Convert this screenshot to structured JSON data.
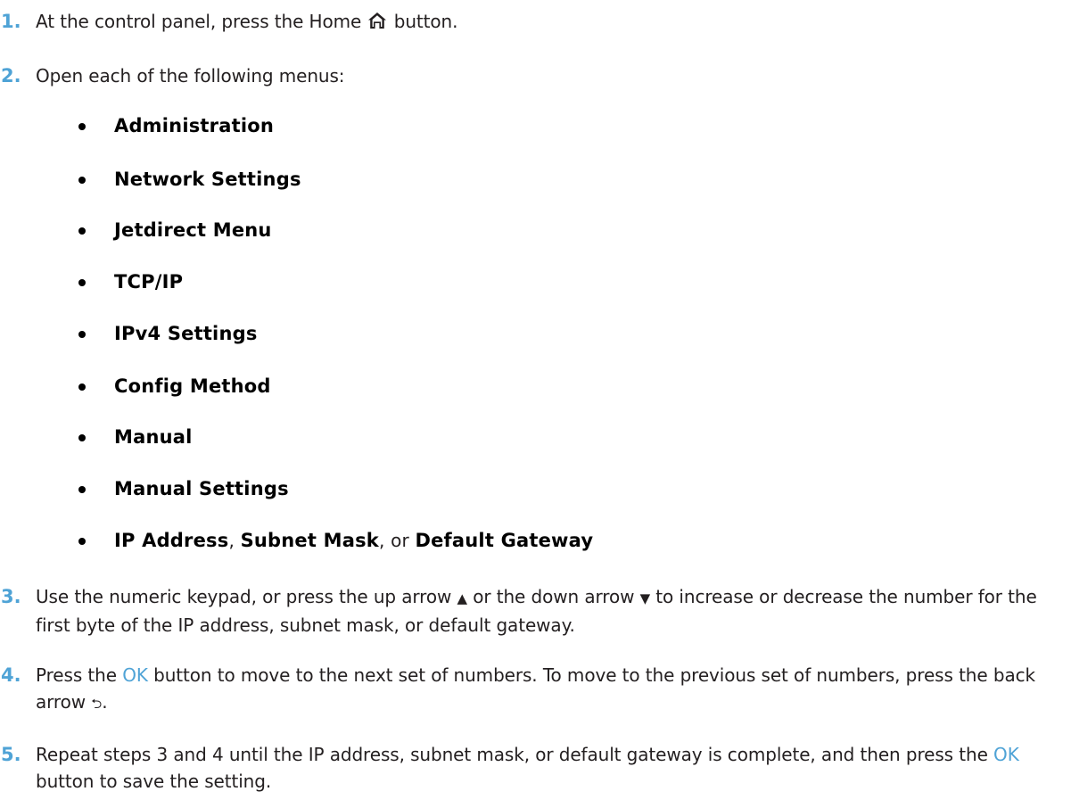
{
  "steps": {
    "s1": {
      "number": "1.",
      "text_before": "At the control panel, press the Home",
      "icon": "home-icon",
      "text_after": " button."
    },
    "s2": {
      "number": "2.",
      "text": "Open each of the following menus:"
    },
    "s3": {
      "number": "3.",
      "text_1": "Use the numeric keypad, or press the up arrow ",
      "up_arrow": "▲",
      "text_2": " or the down arrow ",
      "down_arrow": "▼",
      "text_3": " to increase or decrease the number for the first byte of the IP address, subnet mask, or default gateway."
    },
    "s4": {
      "number": "4.",
      "text_1": "Press the ",
      "ok": "OK",
      "text_2": " button to move to the next set of numbers. To move to the previous set of numbers, press the back arrow ",
      "back_arrow": "⮌",
      "text_3": "."
    },
    "s5": {
      "number": "5.",
      "text_1": "Repeat steps 3 and 4 until the IP address, subnet mask, or default gateway is complete, and then press the ",
      "ok": "OK",
      "text_2": " button to save the setting."
    }
  },
  "menus": [
    "Administration",
    "Network Settings",
    "Jetdirect Menu",
    "TCP/IP",
    "IPv4 Settings",
    "Config Method",
    "Manual",
    "Manual Settings"
  ],
  "last_menu": {
    "item_1": "IP Address",
    "sep_1": ", ",
    "item_2": "Subnet Mask",
    "sep_2": ", or ",
    "item_3": "Default Gateway"
  },
  "colors": {
    "accent": "#4fa3d6",
    "text": "#231f20"
  }
}
